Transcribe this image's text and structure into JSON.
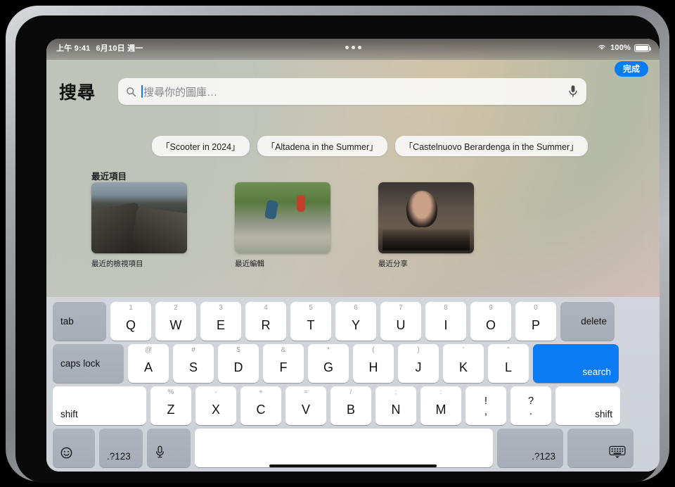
{
  "status_bar": {
    "time": "上午 9:41",
    "date": "6月10日 週一",
    "wifi_icon": "wifi-icon",
    "battery_percent": "100%",
    "multitask_handle": "multitasking-dots"
  },
  "header": {
    "done_label": "完成",
    "title": "搜尋"
  },
  "search": {
    "placeholder": "搜尋你的圖庫…",
    "value": "",
    "search_icon": "search-icon",
    "dictation_icon": "microphone-icon"
  },
  "suggestion_chips": [
    "「Scooter in 2024」",
    "「Altadena in the Summer」",
    "「Castelnuovo Berardenga in the Summer」"
  ],
  "recents": {
    "section_title": "最近項目",
    "items": [
      {
        "label": "最近的檢視項目"
      },
      {
        "label": "最近編輯"
      },
      {
        "label": "最近分享"
      }
    ]
  },
  "keyboard": {
    "row1": [
      {
        "key": "tab",
        "type": "gray-left"
      },
      {
        "key": "Q",
        "hint": "1"
      },
      {
        "key": "W",
        "hint": "2"
      },
      {
        "key": "E",
        "hint": "3"
      },
      {
        "key": "R",
        "hint": "4"
      },
      {
        "key": "T",
        "hint": "5"
      },
      {
        "key": "Y",
        "hint": "6"
      },
      {
        "key": "U",
        "hint": "7"
      },
      {
        "key": "I",
        "hint": "8"
      },
      {
        "key": "O",
        "hint": "9"
      },
      {
        "key": "P",
        "hint": "0"
      },
      {
        "key": "delete",
        "type": "gray-right"
      }
    ],
    "row2": [
      {
        "key": "caps lock",
        "type": "gray-left"
      },
      {
        "key": "A",
        "hint": "@"
      },
      {
        "key": "S",
        "hint": "#"
      },
      {
        "key": "D",
        "hint": "$"
      },
      {
        "key": "F",
        "hint": "&"
      },
      {
        "key": "G",
        "hint": "*"
      },
      {
        "key": "H",
        "hint": "("
      },
      {
        "key": "J",
        "hint": ")"
      },
      {
        "key": "K",
        "hint": "'"
      },
      {
        "key": "L",
        "hint": "\""
      },
      {
        "key": "search",
        "type": "blue"
      }
    ],
    "row3": [
      {
        "key": "shift",
        "type": "white-left"
      },
      {
        "key": "Z",
        "hint": "%"
      },
      {
        "key": "X",
        "hint": "-"
      },
      {
        "key": "C",
        "hint": "+"
      },
      {
        "key": "V",
        "hint": "="
      },
      {
        "key": "B",
        "hint": "/"
      },
      {
        "key": "N",
        "hint": ";"
      },
      {
        "key": "M",
        "hint": ":"
      },
      {
        "key": ",",
        "upper": "!"
      },
      {
        "key": ".",
        "upper": "?"
      },
      {
        "key": "shift",
        "type": "white-right"
      }
    ],
    "row4": [
      {
        "key": "emoji-icon",
        "type": "gray-icon"
      },
      {
        "key": ".?123",
        "type": "gray-left"
      },
      {
        "key": "microphone-icon",
        "type": "gray-icon"
      },
      {
        "key": "space",
        "type": "space"
      },
      {
        "key": ".?123",
        "type": "gray-right"
      },
      {
        "key": "hide-keyboard-icon",
        "type": "gray-icon-right"
      }
    ]
  },
  "colors": {
    "accent_blue": "#0a7bf2",
    "key_white": "#ffffff",
    "key_gray": "#aeb4bd",
    "keyboard_bg": "#d2d5dc",
    "placeholder_gray": "#86868b"
  },
  "home_indicator": "home-indicator"
}
